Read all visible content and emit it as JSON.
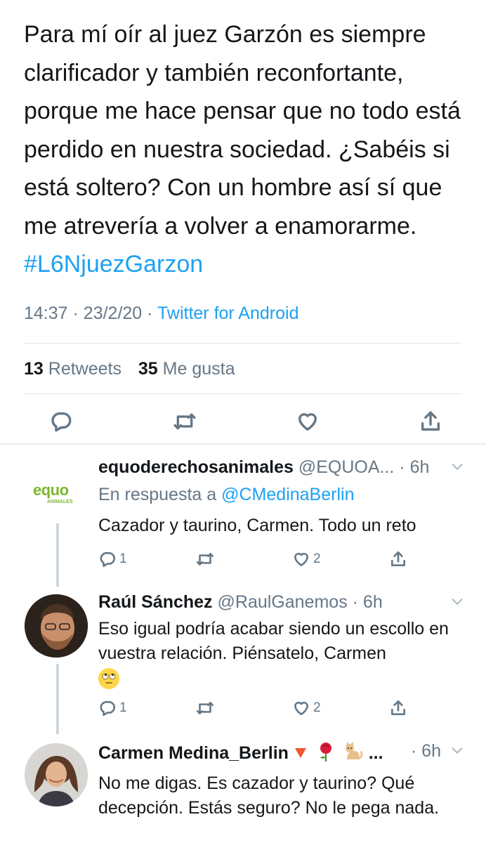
{
  "tweet": {
    "text": "Para mí oír al juez Garzón es siempre clarificador y también reconfortante, porque me hace pensar que no todo está perdido en nuestra sociedad. ¿Sabéis si está soltero? Con un hombre así sí que me atrevería a volver a enamorarme.",
    "hashtag": "#L6NjuezGarzon",
    "time": "14:37",
    "date": "23/2/20",
    "separator": "·",
    "source": "Twitter for Android",
    "retweets_count": "13",
    "retweets_label": "Retweets",
    "likes_count": "35",
    "likes_label": "Me gusta"
  },
  "replies": [
    {
      "name": "equoderechosanimales",
      "handle": "@EQUOA...",
      "time": "· 6h",
      "in_reply_prefix": "En respuesta a",
      "in_reply_handle": "@CMedinaBerlin",
      "text": "Cazador y taurino, Carmen. Todo un reto",
      "reply_count": "1",
      "like_count": "2",
      "avatar_logo": "equo",
      "avatar_sub": "ANIMALES"
    },
    {
      "name": "Raúl Sánchez",
      "handle": "@RaulGanemos",
      "time": "· 6h",
      "text": "Eso igual podría acabar siendo un escollo en vuestra relación. Piénsatelo, Carmen",
      "emoji": "face-with-rolling-eyes",
      "reply_count": "1",
      "like_count": "2"
    },
    {
      "name": "Carmen Medina_Berlin",
      "name_suffix": "...",
      "name_emojis": [
        "down-triangle",
        "rose",
        "cat"
      ],
      "time": "· 6h",
      "text": "No me digas. Es cazador y taurino?  Qué decepción. Estás seguro? No le pega nada."
    }
  ],
  "icons": {
    "reply": "reply-icon",
    "retweet": "retweet-icon",
    "like": "heart-icon",
    "share": "share-icon",
    "more": "chevron-down-icon"
  },
  "colors": {
    "accent": "#1da1f2",
    "text": "#14171a",
    "muted": "#657786",
    "divider": "#e1e8ed",
    "thread_line": "#ccd6dd",
    "equo_green": "#7cb82f"
  }
}
